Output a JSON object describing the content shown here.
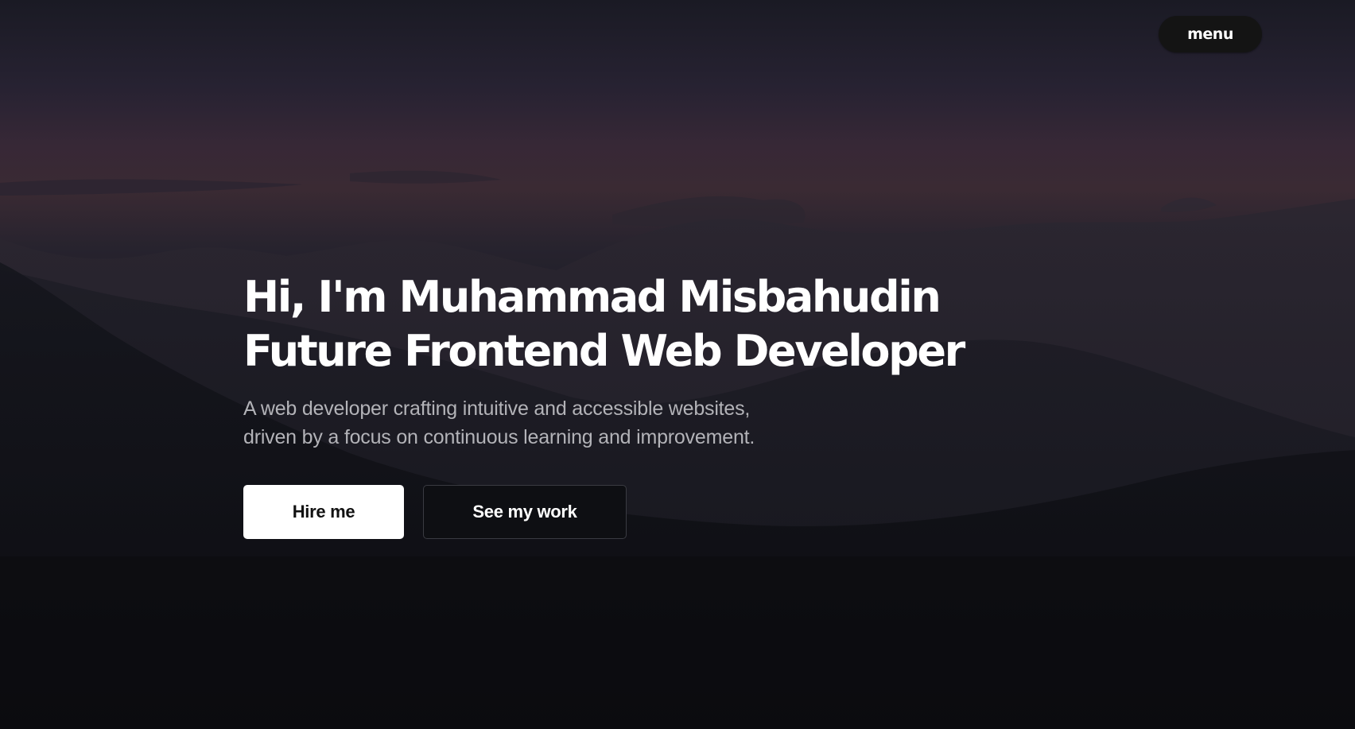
{
  "nav": {
    "menu_label": "menu"
  },
  "hero": {
    "headline_line1": "Hi, I'm Muhammad Misbahudin",
    "headline_line2": "Future Frontend Web Developer",
    "subtitle_line1": "A web developer crafting intuitive and accessible websites,",
    "subtitle_line2": "driven by a focus on continuous learning and improvement.",
    "primary_button": "Hire me",
    "secondary_button": "See my work"
  },
  "colors": {
    "text_primary": "#ffffff",
    "text_secondary": "#b3b3b8",
    "menu_background": "#141414",
    "primary_button_background": "#ffffff",
    "secondary_button_border": "#3a3b42"
  }
}
